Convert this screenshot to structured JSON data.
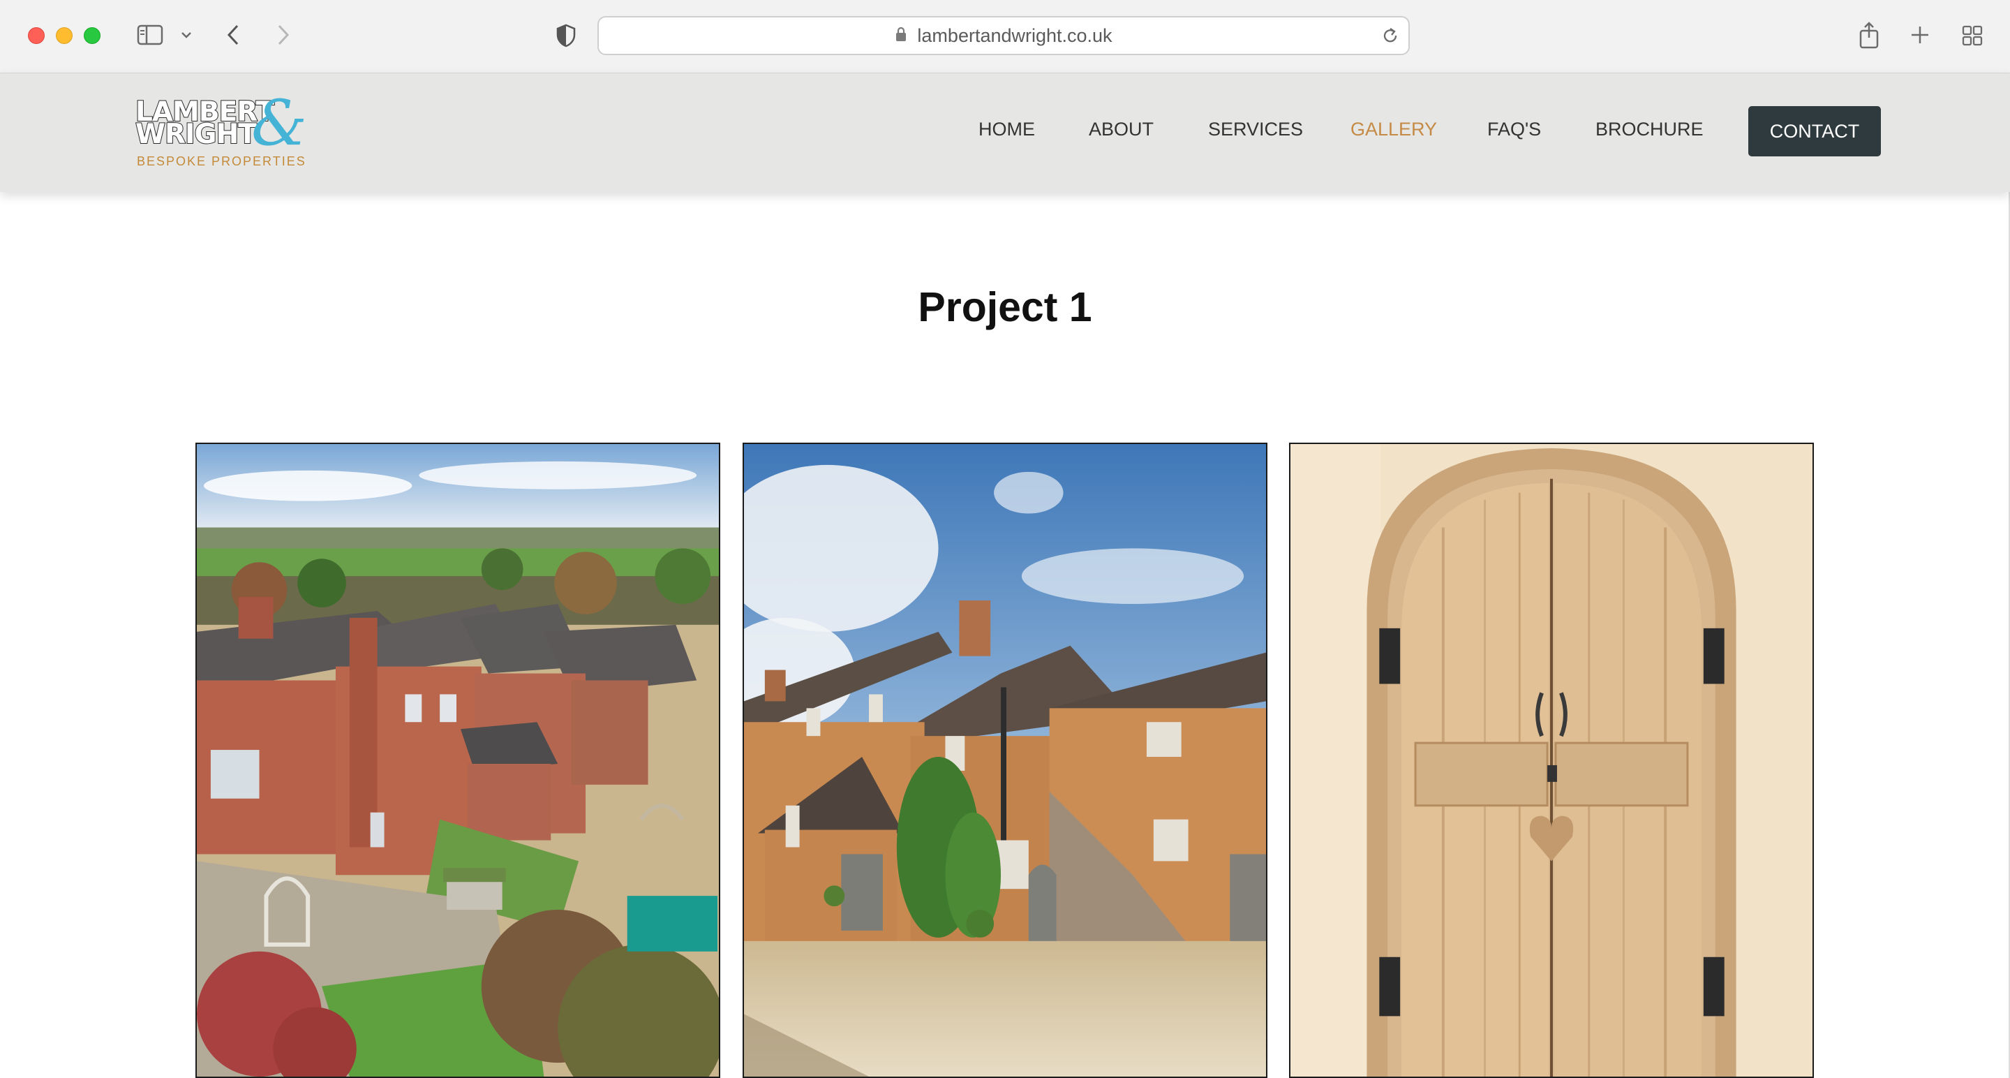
{
  "browser": {
    "url": "lambertandwright.co.uk",
    "icons": [
      "sidebar-icon",
      "chevron-down-icon",
      "back-arrow-icon",
      "forward-arrow-icon",
      "privacy-shield-icon",
      "lock-icon",
      "reload-icon",
      "share-icon",
      "new-tab-plus-icon",
      "tab-overview-icon"
    ]
  },
  "site": {
    "logo": {
      "line1": "LAMBERT",
      "line2": "WRIGHT",
      "ampersand": "&",
      "tagline": "BESPOKE PROPERTIES"
    },
    "nav": [
      {
        "label": "HOME",
        "active": false
      },
      {
        "label": "ABOUT",
        "active": false
      },
      {
        "label": "SERVICES",
        "active": false
      },
      {
        "label": "GALLERY",
        "active": true
      },
      {
        "label": "FAQ'S",
        "active": false
      },
      {
        "label": "BROCHURE",
        "active": false
      }
    ],
    "contact_label": "CONTACT",
    "colors": {
      "accent": "#c58a45",
      "header_bg": "#e6e6e4",
      "button_bg": "#2e3a3d",
      "logo_blue": "#45b3d6"
    }
  },
  "main": {
    "title": "Project 1",
    "gallery": [
      {
        "subject": "aerial view of brick farmhouse and garden"
      },
      {
        "subject": "brick courtyard house with gravel drive"
      },
      {
        "subject": "arched reclaimed pine double doors"
      }
    ]
  }
}
